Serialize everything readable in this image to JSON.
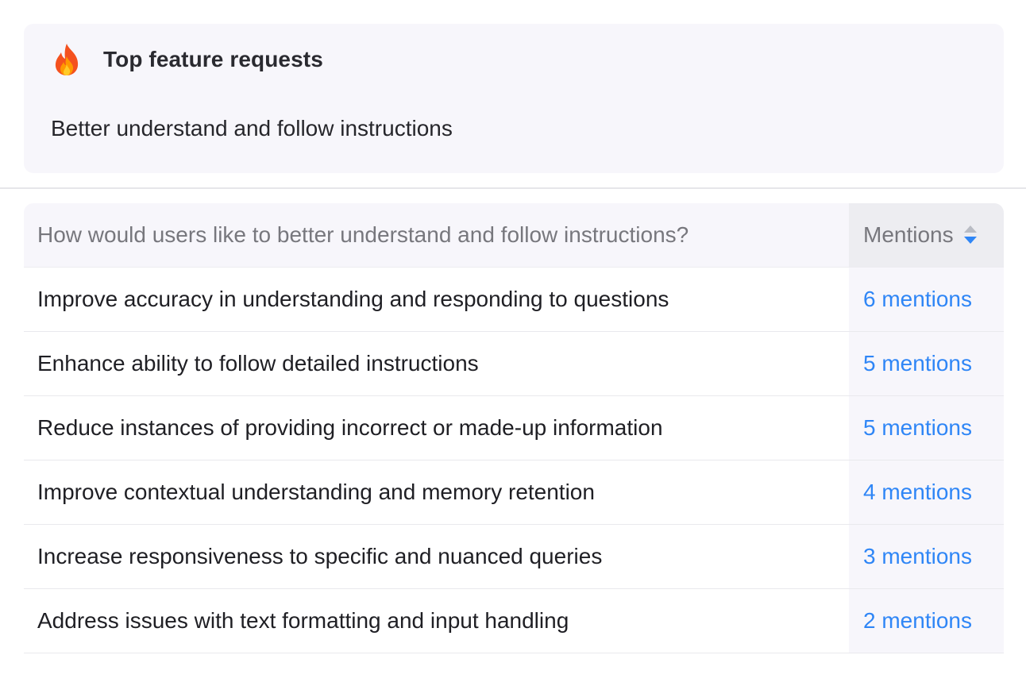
{
  "summary": {
    "icon": "fire-icon",
    "title": "Top feature requests",
    "text": "Better understand and follow instructions"
  },
  "table": {
    "header": {
      "question": "How would users like to better understand and follow instructions?",
      "mentions": "Mentions",
      "sort_icon": "sort-updown-icon"
    },
    "rows": [
      {
        "label": "Improve accuracy in understanding and responding to questions",
        "count": "6 mentions"
      },
      {
        "label": "Enhance ability to follow detailed instructions",
        "count": "5 mentions"
      },
      {
        "label": "Reduce instances of providing incorrect or made-up information",
        "count": "5 mentions"
      },
      {
        "label": "Improve contextual understanding and memory retention",
        "count": "4 mentions"
      },
      {
        "label": "Increase responsiveness to specific and nuanced queries",
        "count": "3 mentions"
      },
      {
        "label": "Address issues with text formatting and input handling",
        "count": "2 mentions"
      }
    ]
  },
  "colors": {
    "accent": "#2f86f6",
    "card_background": "#f7f6fb",
    "header_text": "#77777d",
    "flame_outer": "#f4511e",
    "flame_inner": "#ffca28"
  }
}
